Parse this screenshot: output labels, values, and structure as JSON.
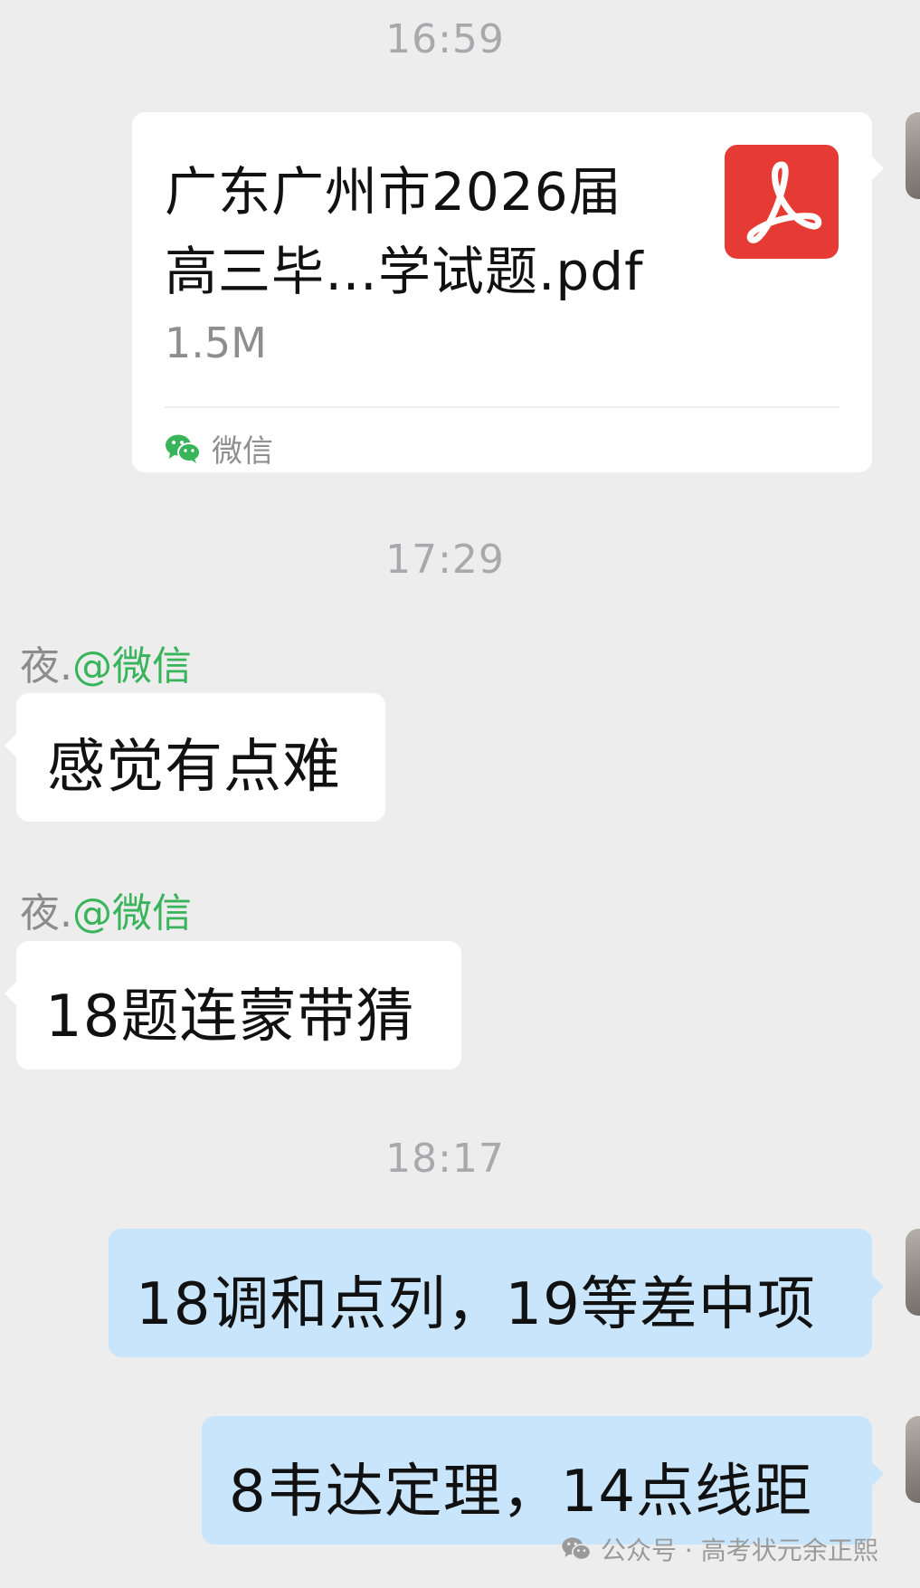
{
  "timestamps": [
    "16:59",
    "17:29",
    "18:17"
  ],
  "file_message": {
    "title_line1": "广东广州市2026届",
    "title_line2": "高三毕…学试题.pdf",
    "size": "1.5M",
    "file_icon": "pdf-icon",
    "source_icon": "wechat-icon",
    "source_label": "微信"
  },
  "messages": [
    {
      "sender_name": "夜.",
      "sender_handle": "@微信",
      "text": "感觉有点难"
    },
    {
      "sender_name": "夜.",
      "sender_handle": "@微信",
      "text": "18题连蒙带猜"
    },
    {
      "text": "18调和点列，19等差中项"
    },
    {
      "text": "8韦达定理，14点线距"
    }
  ],
  "watermark": {
    "icon": "wechat-icon",
    "text": "公众号 · 高考状元余正熙"
  },
  "colors": {
    "background": "#ededee",
    "incoming_bubble": "#ffffff",
    "outgoing_bubble": "#c9e5fb",
    "pdf_red": "#e63b35",
    "wechat_green": "#38b45b"
  }
}
